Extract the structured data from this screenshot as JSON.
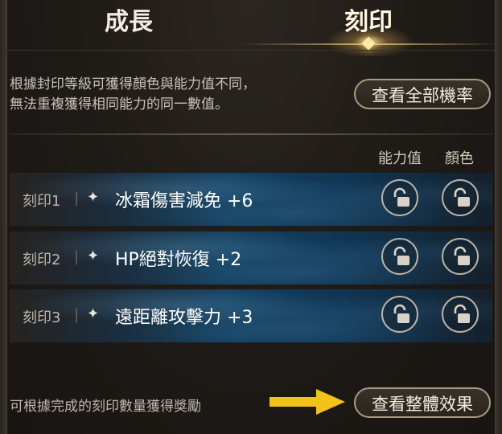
{
  "tabs": {
    "growth": "成長",
    "imprint": "刻印"
  },
  "info": {
    "line1": "根據封印等級可獲得顏色與能力值不同，",
    "line2": "無法重複獲得相同能力的同一數值。"
  },
  "buttons": {
    "view_all_rates": "查看全部機率",
    "view_overall_effect": "查看整體效果"
  },
  "columns": {
    "ability": "能力值",
    "color": "顏色"
  },
  "rows": [
    {
      "label": "刻印1",
      "text": "冰霜傷害減免 +6"
    },
    {
      "label": "刻印2",
      "text": "HP絕對恢復 +2"
    },
    {
      "label": "刻印3",
      "text": "遠距離攻擊力 +3"
    }
  ],
  "bottom": {
    "note": "可根據完成的刻印數量獲得獎勵"
  },
  "colors": {
    "accent_gold": "#f2c218",
    "panel_blue": "#134060",
    "button_border": "#a89a83"
  },
  "icons": [
    "sparkle-icon",
    "unlock-icon",
    "arrow-right-icon"
  ]
}
